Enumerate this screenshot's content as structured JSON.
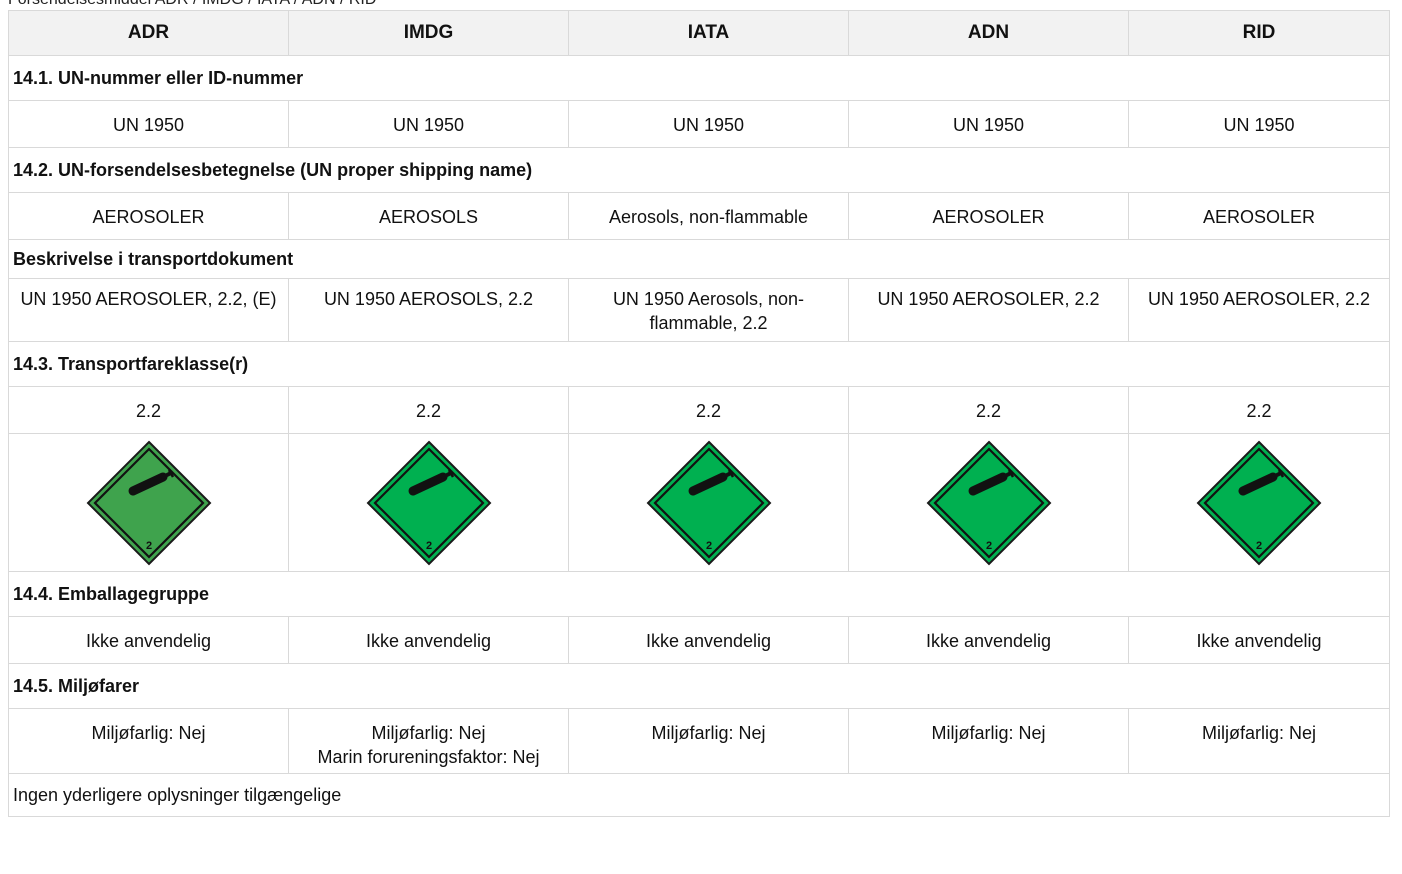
{
  "caption": "Forsendelsesmiddel ADR / IMDG / IATA / ADN / RID",
  "columns": [
    "ADR",
    "IMDG",
    "IATA",
    "ADN",
    "RID"
  ],
  "sections": {
    "un_number": {
      "title": "14.1. UN-nummer eller ID-nummer",
      "values": [
        "UN 1950",
        "UN 1950",
        "UN 1950",
        "UN 1950",
        "UN 1950"
      ]
    },
    "shipping_name": {
      "title": "14.2. UN-forsendelsesbetegnelse (UN proper shipping name)",
      "values": [
        "AEROSOLER",
        "AEROSOLS",
        "Aerosols, non-flammable",
        "AEROSOLER",
        "AEROSOLER"
      ]
    },
    "transport_doc": {
      "title": "Beskrivelse i transportdokument",
      "values": [
        "UN 1950 AEROSOLER, 2.2, (E)",
        "UN 1950 AEROSOLS, 2.2",
        "UN 1950 Aerosols, non-flammable, 2.2",
        "UN 1950 AEROSOLER, 2.2",
        "UN 1950 AEROSOLER, 2.2"
      ]
    },
    "hazard_class": {
      "title": "14.3. Transportfareklasse(r)",
      "values": [
        "2.2",
        "2.2",
        "2.2",
        "2.2",
        "2.2"
      ],
      "label_number": "2",
      "label_icons": [
        "gas-cylinder-hazard-label-icon",
        "gas-cylinder-hazard-label-icon",
        "gas-cylinder-hazard-label-icon",
        "gas-cylinder-hazard-label-icon",
        "gas-cylinder-hazard-label-icon"
      ],
      "label_colors": [
        "#3fa34d",
        "#00b050",
        "#00b050",
        "#00b050",
        "#00b050"
      ]
    },
    "packing_group": {
      "title": "14.4. Emballagegruppe",
      "values": [
        "Ikke anvendelig",
        "Ikke anvendelig",
        "Ikke anvendelig",
        "Ikke anvendelig",
        "Ikke anvendelig"
      ]
    },
    "environment": {
      "title": "14.5. Miljøfarer",
      "line1": [
        "Miljøfarlig: Nej",
        "Miljøfarlig: Nej",
        "Miljøfarlig: Nej",
        "Miljøfarlig: Nej",
        "Miljøfarlig: Nej"
      ],
      "line2": [
        "",
        "Marin forureningsfaktor: Nej",
        "",
        "",
        ""
      ]
    }
  },
  "footer": "Ingen yderligere oplysninger tilgængelige"
}
